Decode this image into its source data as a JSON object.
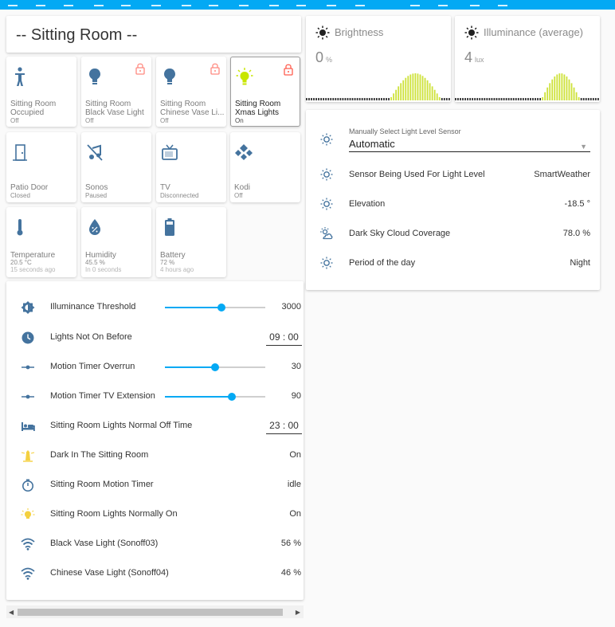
{
  "colors": {
    "accent": "#03a9f4",
    "icon_blue": "#44739e",
    "active_yellow": "#c8e600",
    "lock_red": "#ff5c4d",
    "history_bar": "#cee23b"
  },
  "title": "-- Sitting Room --",
  "tiles_row1": [
    {
      "name_line1": "Sitting Room",
      "name_line2": "Occupied",
      "state": "Off",
      "icon": "walking-person-icon",
      "locked": false,
      "active": false
    },
    {
      "name_line1": "Sitting Room",
      "name_line2": "Black Vase Light",
      "state": "Off",
      "icon": "lightbulb-icon",
      "locked": true,
      "active": false
    },
    {
      "name_line1": "Sitting Room",
      "name_line2": "Chinese Vase Li...",
      "state": "Off",
      "icon": "lightbulb-icon",
      "locked": true,
      "active": false
    },
    {
      "name_line1": "Sitting Room",
      "name_line2": "Xmas Lights",
      "state": "On",
      "icon": "lightbulb-on-icon",
      "locked": true,
      "active": true
    }
  ],
  "tiles_row2": [
    {
      "name": "Patio Door",
      "state": "Closed",
      "icon": "door-icon"
    },
    {
      "name": "Sonos",
      "state": "Paused",
      "icon": "music-off-icon"
    },
    {
      "name": "TV",
      "state": "Disconnected",
      "icon": "tv-icon"
    },
    {
      "name": "Kodi",
      "state": "Off",
      "icon": "kodi-icon"
    }
  ],
  "tiles_row3": [
    {
      "name": "Temperature",
      "value": "20.5 °C",
      "updated": "15 seconds ago",
      "icon": "thermometer-icon"
    },
    {
      "name": "Humidity",
      "value": "45.5 %",
      "updated": "In 0 seconds",
      "icon": "water-percent-icon"
    },
    {
      "name": "Battery",
      "value": "72 %",
      "updated": "4 hours ago",
      "icon": "battery-icon"
    }
  ],
  "entities": [
    {
      "label": "Illuminance Threshold",
      "value": "3000",
      "icon": "contrast-icon",
      "type": "slider",
      "fraction": 0.56
    },
    {
      "label": "Lights Not On Before",
      "value": "09 : 00",
      "icon": "clock-icon",
      "type": "time"
    },
    {
      "label": "Motion Timer Overrun",
      "value": "30",
      "icon": "ray-vertex-icon",
      "type": "slider",
      "fraction": 0.5
    },
    {
      "label": "Motion Timer TV Extension",
      "value": "90",
      "icon": "ray-vertex-icon",
      "type": "slider",
      "fraction": 0.67
    },
    {
      "label": "Sitting Room Lights Normal Off Time",
      "value": "23 : 00",
      "icon": "bed-icon",
      "type": "time"
    },
    {
      "label": "Dark In The Sitting Room",
      "value": "On",
      "icon": "lighthouse-icon",
      "type": "text"
    },
    {
      "label": "Sitting Room Motion Timer",
      "value": "idle",
      "icon": "timer-icon",
      "type": "text"
    },
    {
      "label": "Sitting Room Lights Normally On",
      "value": "On",
      "icon": "lightbulb-on-icon",
      "type": "text"
    },
    {
      "label": "Black Vase Light (Sonoff03)",
      "value": "56 %",
      "icon": "wifi-icon",
      "type": "text"
    },
    {
      "label": "Chinese Vase Light (Sonoff04)",
      "value": "46 %",
      "icon": "wifi-icon",
      "type": "text"
    }
  ],
  "sensors": [
    {
      "name": "Brightness",
      "value": "0",
      "unit": "%",
      "icon": "brightness-icon"
    },
    {
      "name": "Illuminance (average)",
      "value": "4",
      "unit": "lux",
      "icon": "brightness-icon"
    }
  ],
  "info": {
    "select_label": "Manually Select Light Level Sensor",
    "select_value": "Automatic",
    "rows": [
      {
        "label": "Sensor Being Used For Light Level",
        "value": "SmartWeather",
        "icon": "sun-outline-icon"
      },
      {
        "label": "Elevation",
        "value": "-18.5 °",
        "icon": "sun-outline-icon"
      },
      {
        "label": "Dark Sky Cloud Coverage",
        "value": "78.0 %",
        "icon": "weather-partly-cloudy-icon"
      },
      {
        "label": "Period of the day",
        "value": "Night",
        "icon": "sun-outline-icon"
      }
    ]
  }
}
